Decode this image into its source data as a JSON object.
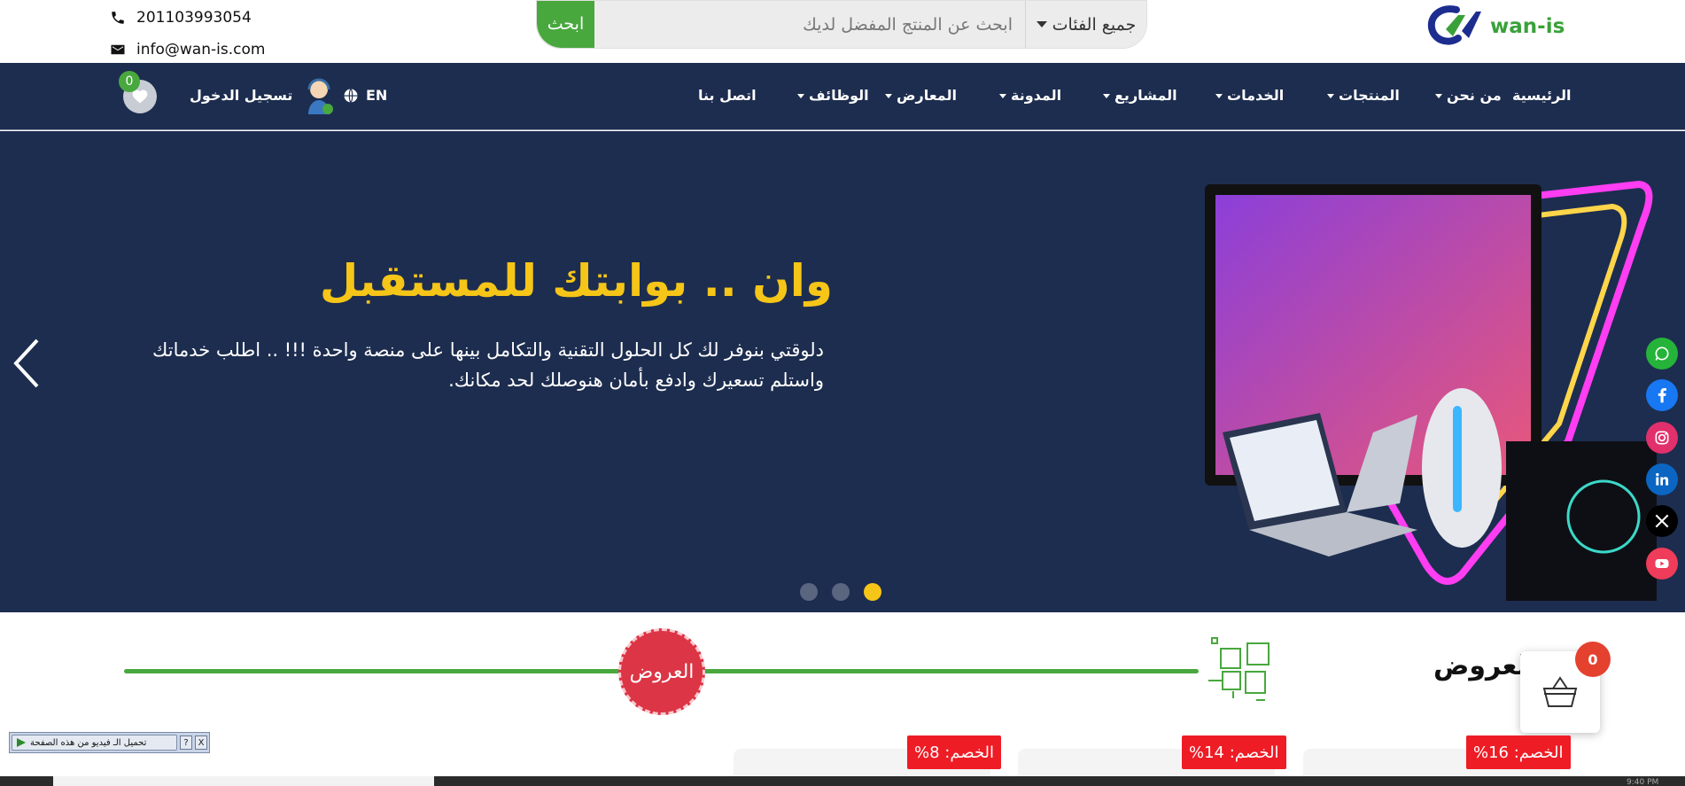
{
  "contact": {
    "phone": "201103993054",
    "email": "info@wan-is.com"
  },
  "search": {
    "button_label": "ابحث",
    "placeholder": "ابحث عن المنتج المفضل لديك",
    "category_label": "جميع الفئات"
  },
  "logo": {
    "text": "wan-is"
  },
  "nav": {
    "items": [
      {
        "label": "الرئيسية"
      },
      {
        "label": "من نحن"
      },
      {
        "label": "المنتجات"
      },
      {
        "label": "الخدمات"
      },
      {
        "label": "المشاريع"
      },
      {
        "label": "المدونة"
      },
      {
        "label": "المعارض"
      },
      {
        "label": "الوظائف"
      },
      {
        "label": "اتصل بنا"
      }
    ],
    "lang_label": "EN",
    "login_label": "تسجيل الدخول",
    "wishlist_count": "0"
  },
  "hero": {
    "title": "وان .. بوابتك للمستقبل",
    "line1": "دلوقتي بنوفر لك كل الحلول التقنية والتكامل بينها على منصة واحدة !!! .. اطلب خدماتك",
    "line2": "واستلم تسعيرك وادفع بأمان هنوصلك لحد مكانك.",
    "slide_count": 3,
    "active_slide": 3
  },
  "social": [
    "whatsapp-icon",
    "facebook-icon",
    "instagram-icon",
    "linkedin-icon",
    "x-icon",
    "youtube-icon"
  ],
  "offers": {
    "badge": "العروض",
    "title": "العروض",
    "cart_count": "0",
    "discounts": [
      "الخصم: 16%",
      "الخصم: 14%",
      "الخصم: 8%"
    ]
  },
  "video_toolbar": {
    "label": "تحميل الـ فيديو من هذه الصفحة",
    "help": "?",
    "close": "X"
  },
  "taskbar": {
    "time": "9:40 PM"
  },
  "colors": {
    "navy": "#1d2d4f",
    "green": "#48a83e",
    "yellow": "#f5c518",
    "red": "#dc3545"
  }
}
